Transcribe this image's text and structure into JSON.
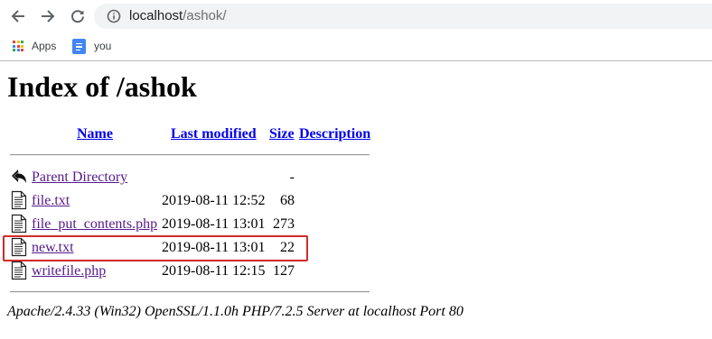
{
  "browser": {
    "url_host": "localhost",
    "url_path": "/ashok/",
    "bookmarks": [
      {
        "label": "Apps",
        "icon": "apps-grid-icon"
      },
      {
        "label": "you",
        "icon": "google-docs-icon"
      }
    ]
  },
  "page": {
    "title": "Index of /ashok",
    "columns": {
      "name": "Name",
      "last_modified": "Last modified",
      "size": "Size",
      "description": "Description"
    },
    "entries": [
      {
        "name": "Parent Directory",
        "modified": "",
        "size": "-",
        "icon": "back-arrow-icon"
      },
      {
        "name": "file.txt",
        "modified": "2019-08-11 12:52",
        "size": "68",
        "icon": "text-file-icon"
      },
      {
        "name": "file_put_contents.php",
        "modified": "2019-08-11 13:01",
        "size": "273",
        "icon": "text-file-icon"
      },
      {
        "name": "new.txt",
        "modified": "2019-08-11 13:01",
        "size": "22",
        "icon": "text-file-icon",
        "highlighted": true
      },
      {
        "name": "writefile.php",
        "modified": "2019-08-11 12:15",
        "size": "127",
        "icon": "text-file-icon"
      }
    ],
    "server_signature": "Apache/2.4.33 (Win32) OpenSSL/1.1.0h PHP/7.2.5 Server at localhost Port 80"
  },
  "colors": {
    "link": "#0000ee",
    "visited_link": "#551a8b",
    "highlight_box": "#d42a2a",
    "omnibox_bg": "#f1f3f4"
  }
}
